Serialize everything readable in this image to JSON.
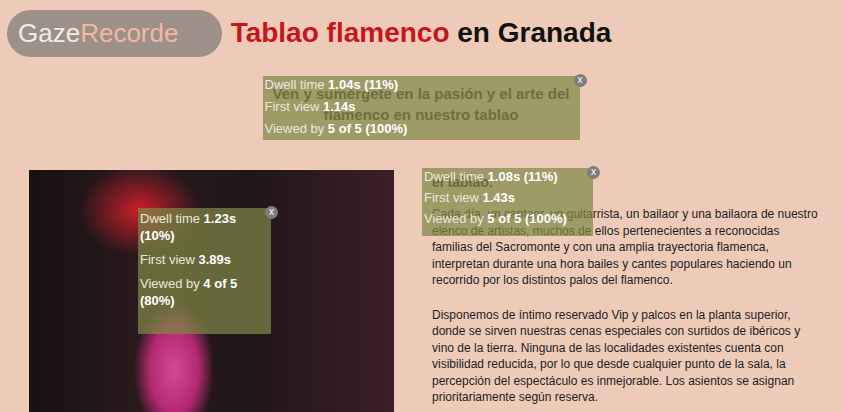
{
  "logo": {
    "first": "Gaze",
    "second": "Recorde"
  },
  "header": {
    "title_highlight": "Tablao flamenco",
    "title_rest": "en Granada"
  },
  "subtitle": {
    "text": "Ven y sumérgete en la pasión y el arte del flamenco en nuestro tablao",
    "gaze": {
      "close": "x",
      "stats": [
        {
          "label": "Dwell time",
          "value": "1.04s (11%)"
        },
        {
          "label": "First view",
          "value": "1.14s"
        },
        {
          "label": "Viewed by",
          "value": "5 of 5 (100%)"
        }
      ]
    }
  },
  "photo": {
    "gaze": {
      "close": "x",
      "stats": [
        {
          "label": "Dwell time",
          "value": "1.23s (10%)"
        },
        {
          "label": "First view",
          "value": "3.89s"
        },
        {
          "label": "Viewed by",
          "value": "4 of 5 (80%)"
        }
      ]
    }
  },
  "article": {
    "heading": "el tablao.",
    "gaze": {
      "close": "x",
      "stats": [
        {
          "label": "Dwell time",
          "value": "1.08s (11%)"
        },
        {
          "label": "First view",
          "value": "1.43s"
        },
        {
          "label": "Viewed by",
          "value": "5 of 5 (100%)"
        }
      ]
    },
    "paragraphs": [
      "Cada día, un cantaor, un guitarrista, un bailaor y una bailaora de nuestro elenco de artistas, muchos de ellos pertenecientes a reconocidas familias del Sacromonte y con una amplia trayectoria flamenca, interpretan durante una hora bailes y cantes populares haciendo un recorrido por los distintos palos del flamenco.",
      "Disponemos de íntimo reservado Vip y palcos en la planta superior, donde se sirven nuestras cenas especiales con surtidos de ibéricos y vino de la tierra. Ninguna de las localidades existentes cuenta con visibilidad reducida, por lo que desde cualquier punto de la sala, la percepción del espectáculo es inmejorable. Los asientos se asignan prioritariamente según reserva."
    ]
  }
}
